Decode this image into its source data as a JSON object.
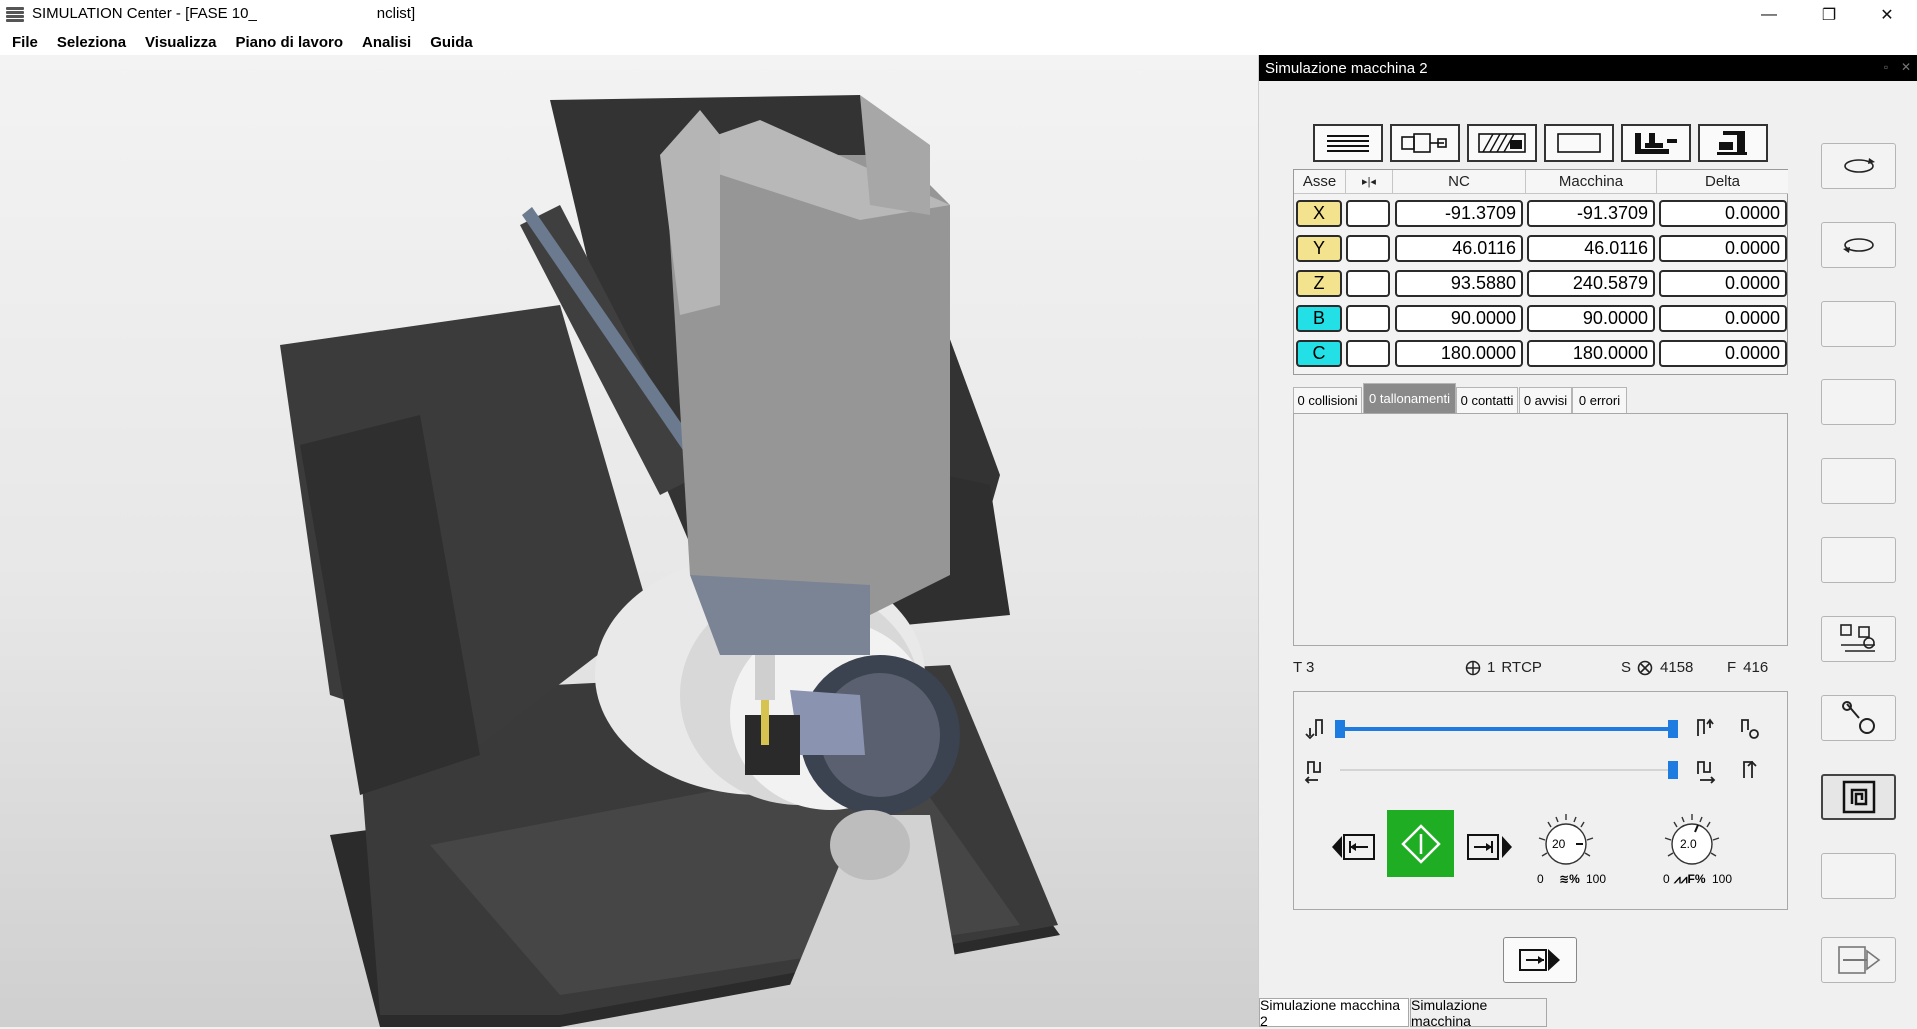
{
  "window": {
    "title_prefix": "SIMULATION Center - [FASE 10_",
    "title_suffix": "nclist]",
    "minimize": "—",
    "restore": "❐",
    "close": "✕"
  },
  "menu": [
    "File",
    "Seleziona",
    "Visualizza",
    "Piano di lavoro",
    "Analisi",
    "Guida"
  ],
  "panel": {
    "title": "Simulazione macchina 2",
    "table": {
      "headers": [
        "Asse",
        "▸|◂",
        "NC",
        "Macchina",
        "Delta"
      ],
      "rows": [
        {
          "axis": "X",
          "nc": "-91.3709",
          "machine": "-91.3709",
          "delta": "0.0000",
          "color": "#f3e38f"
        },
        {
          "axis": "Y",
          "nc": "46.0116",
          "machine": "46.0116",
          "delta": "0.0000",
          "color": "#f3e38f"
        },
        {
          "axis": "Z",
          "nc": "93.5880",
          "machine": "240.5879",
          "delta": "0.0000",
          "color": "#f3e38f"
        },
        {
          "axis": "B",
          "nc": "90.0000",
          "machine": "90.0000",
          "delta": "0.0000",
          "color": "#22e0e6"
        },
        {
          "axis": "C",
          "nc": "180.0000",
          "machine": "180.0000",
          "delta": "0.0000",
          "color": "#22e0e6"
        }
      ]
    },
    "message_tabs": [
      "0 collisioni",
      "0 tallonamenti",
      "0 contatti",
      "0 avvisi",
      "0 errori"
    ],
    "active_message_tab": 1,
    "status": {
      "tool": "T 3",
      "rtcp_num": "1",
      "rtcp": "RTCP",
      "spindle_label": "S",
      "spindle_value": "4158",
      "feed_label": "F",
      "feed_value": "416"
    },
    "controls": {
      "speed_dial": {
        "value": "20",
        "min": "0",
        "max": "100",
        "unit": "%"
      },
      "feed_dial": {
        "value": "2.0",
        "min": "0",
        "max": "100",
        "unit": "F%"
      }
    },
    "bottom_tabs": [
      "Simulazione macchina 2",
      "Simulazione macchina"
    ]
  },
  "colors": {
    "play_green": "#1fad24",
    "slider_blue": "#1e7be0",
    "axis_linear": "#f3e38f",
    "axis_rotary": "#22e0e6"
  }
}
